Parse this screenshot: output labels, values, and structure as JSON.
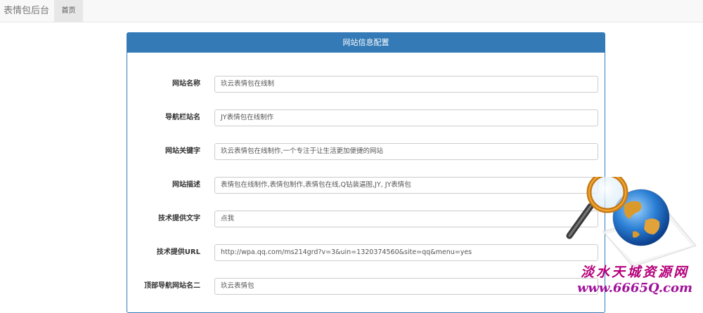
{
  "navbar": {
    "brand": "表情包后台",
    "home_label": "首页"
  },
  "panel": {
    "title": "网站信息配置"
  },
  "form": {
    "fields": [
      {
        "label": "网站名称",
        "value": "玖云表情包在线制"
      },
      {
        "label": "导航栏站名",
        "value": "JY表情包在线制作"
      },
      {
        "label": "网站关键字",
        "value": "玖云表情包在线制作,一个专注于让生活更加便捷的网站"
      },
      {
        "label": "网站描述",
        "value": "表情包在线制作,表情包制作,表情包在线,Q钻装逼图,JY, JY表情包"
      },
      {
        "label": "技术提供文字",
        "value": "点我"
      },
      {
        "label": "技术提供URL",
        "value": "http://wpa.qq.com/ms214grd?v=3&uin=1320374560&site=qq&menu=yes"
      },
      {
        "label": "顶部导航网站名二",
        "value": "玖云表情包"
      }
    ]
  },
  "watermark": {
    "line1": "淡水天城资源网",
    "line2": "www.6665Q.com"
  },
  "colors": {
    "primary": "#337ab7",
    "navbar_bg": "#f8f8f8",
    "watermark": "#b5007a"
  }
}
